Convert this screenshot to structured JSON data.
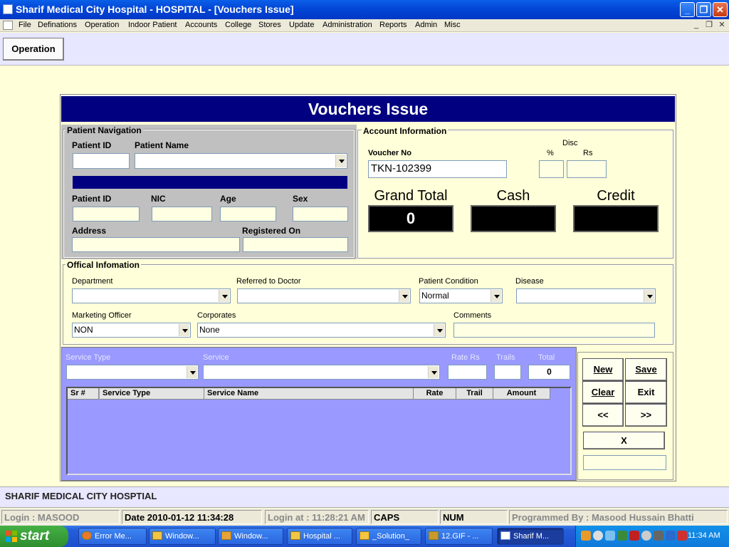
{
  "window": {
    "title": "Sharif Medical City Hospital - HOSPITAL - [Vouchers Issue]"
  },
  "menu": [
    "File",
    "Definations",
    "Operation",
    "Indoor Patient",
    "Accounts",
    "College",
    "Stores",
    "Update",
    "Administration",
    "Reports",
    "Admin",
    "Misc"
  ],
  "toolbar": {
    "operation_label": "Operation"
  },
  "form": {
    "title": "Vouchers Issue"
  },
  "patient_nav": {
    "title": "Patient Navigation",
    "patient_id_label": "Patient ID",
    "patient_name_label": "Patient Name",
    "patient_id_label2": "Patient ID",
    "nic_label": "NIC",
    "age_label": "Age",
    "sex_label": "Sex",
    "address_label": "Address",
    "registered_on_label": "Registered On"
  },
  "account": {
    "title": "Account Information",
    "voucher_no_label": "Voucher No",
    "voucher_no_value": "TKN-102399",
    "disc_label": "Disc",
    "pct_label": "%",
    "rs_label": "Rs",
    "grand_total_label": "Grand Total",
    "grand_total_value": "0",
    "cash_label": "Cash",
    "credit_label": "Credit"
  },
  "official": {
    "title": "Offical Infomation",
    "department_label": "Department",
    "referred_label": "Referred to Doctor",
    "condition_label": "Patient Condition",
    "condition_value": "Normal",
    "disease_label": "Disease",
    "marketing_label": "Marketing Officer",
    "marketing_value": "NON",
    "corporates_label": "Corporates",
    "corporates_value": "None",
    "comments_label": "Comments"
  },
  "services": {
    "service_type_label": "Service Type",
    "service_label": "Service",
    "rate_label": "Rate Rs",
    "trails_label": "Trails",
    "total_label": "Total",
    "total_value": "0",
    "columns": [
      "Sr #",
      "Service Type",
      "Service Name",
      "Rate",
      "Trail",
      "Amount"
    ]
  },
  "actions": {
    "new_label": "New",
    "save_label": "Save",
    "clear_label": "Clear",
    "exit_label": "Exit",
    "prev_label": "<<",
    "next_label": ">>",
    "x_label": "X"
  },
  "footer": {
    "hospital_name": "SHARIF MEDICAL CITY HOSPTIAL"
  },
  "status": {
    "login": "Login :  MASOOD",
    "date": "Date 2010-01-12 11:34:28",
    "login_at": "Login at : 11:28:21 AM",
    "caps": "CAPS",
    "num": "NUM",
    "programmed": "Programmed By : Masood Hussain Bhatti"
  },
  "taskbar": {
    "start_label": "start",
    "tasks": [
      "Error Me...",
      "Window...",
      "Window...",
      "Hospital ...",
      "_Solution_",
      "12.GIF - ...",
      "Sharif M..."
    ],
    "clock": "11:34 AM"
  },
  "colors": {
    "navy": "#000080",
    "panel_gray": "#C0C0C0",
    "lavender": "#9999FF",
    "cream": "#FFFFD9"
  }
}
